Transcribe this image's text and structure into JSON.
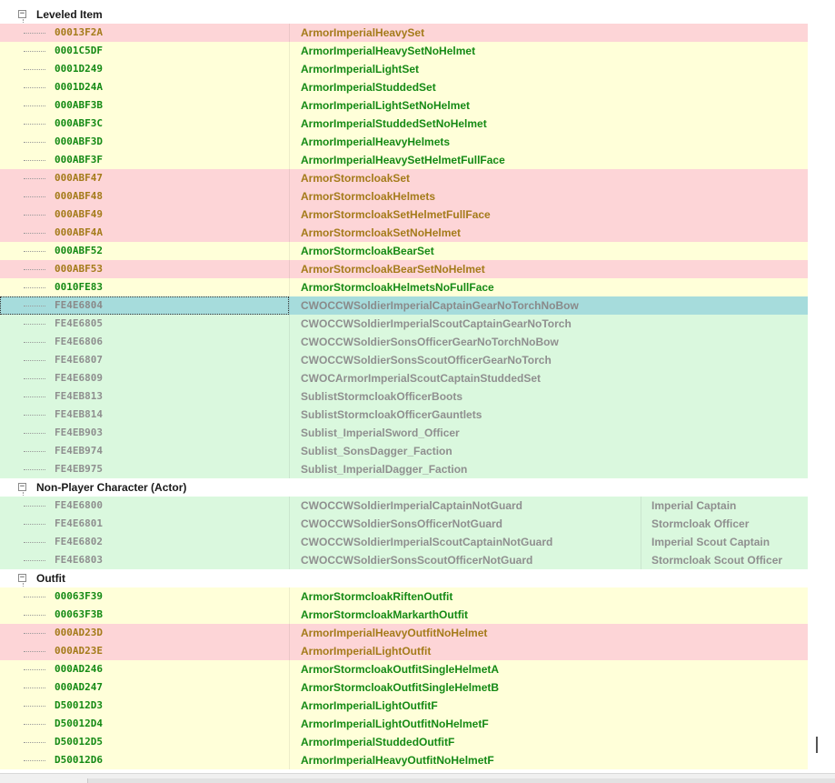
{
  "groups": [
    {
      "label": "Leveled Item",
      "expanded": true,
      "rows": [
        {
          "id": "00013F2A",
          "name": "ArmorImperialHeavySet",
          "state": "pink"
        },
        {
          "id": "0001C5DF",
          "name": "ArmorImperialHeavySetNoHelmet",
          "state": "yellow"
        },
        {
          "id": "0001D249",
          "name": "ArmorImperialLightSet",
          "state": "yellow"
        },
        {
          "id": "0001D24A",
          "name": "ArmorImperialStuddedSet",
          "state": "yellow"
        },
        {
          "id": "000ABF3B",
          "name": "ArmorImperialLightSetNoHelmet",
          "state": "yellow"
        },
        {
          "id": "000ABF3C",
          "name": "ArmorImperialStuddedSetNoHelmet",
          "state": "yellow"
        },
        {
          "id": "000ABF3D",
          "name": "ArmorImperialHeavyHelmets",
          "state": "yellow"
        },
        {
          "id": "000ABF3F",
          "name": "ArmorImperialHeavySetHelmetFullFace",
          "state": "yellow"
        },
        {
          "id": "000ABF47",
          "name": "ArmorStormcloakSet",
          "state": "pink"
        },
        {
          "id": "000ABF48",
          "name": "ArmorStormcloakHelmets",
          "state": "pink"
        },
        {
          "id": "000ABF49",
          "name": "ArmorStormcloakSetHelmetFullFace",
          "state": "pink"
        },
        {
          "id": "000ABF4A",
          "name": "ArmorStormcloakSetNoHelmet",
          "state": "pink"
        },
        {
          "id": "000ABF52",
          "name": "ArmorStormcloakBearSet",
          "state": "yellow"
        },
        {
          "id": "000ABF53",
          "name": "ArmorStormcloakBearSetNoHelmet",
          "state": "pink"
        },
        {
          "id": "0010FE83",
          "name": "ArmorStormcloakHelmetsNoFullFace",
          "state": "yellow"
        },
        {
          "id": "FE4E6804",
          "name": "CWOCCWSoldierImperialCaptainGearNoTorchNoBow",
          "state": "selected"
        },
        {
          "id": "FE4E6805",
          "name": "CWOCCWSoldierImperialScoutCaptainGearNoTorch",
          "state": "green"
        },
        {
          "id": "FE4E6806",
          "name": "CWOCCWSoldierSonsOfficerGearNoTorchNoBow",
          "state": "green"
        },
        {
          "id": "FE4E6807",
          "name": "CWOCCWSoldierSonsScoutOfficerGearNoTorch",
          "state": "green"
        },
        {
          "id": "FE4E6809",
          "name": "CWOCArmorImperialScoutCaptainStuddedSet",
          "state": "green"
        },
        {
          "id": "FE4EB813",
          "name": "SublistStormcloakOfficerBoots",
          "state": "green"
        },
        {
          "id": "FE4EB814",
          "name": "SublistStormcloakOfficerGauntlets",
          "state": "green"
        },
        {
          "id": "FE4EB903",
          "name": "Sublist_ImperialSword_Officer",
          "state": "green"
        },
        {
          "id": "FE4EB974",
          "name": "Sublist_SonsDagger_Faction",
          "state": "green"
        },
        {
          "id": "FE4EB975",
          "name": "Sublist_ImperialDagger_Faction",
          "state": "green"
        }
      ]
    },
    {
      "label": "Non-Player Character (Actor)",
      "expanded": true,
      "rows": [
        {
          "id": "FE4E6800",
          "name": "CWOCCWSoldierImperialCaptainNotGuard",
          "extra": "Imperial Captain",
          "state": "green"
        },
        {
          "id": "FE4E6801",
          "name": "CWOCCWSoldierSonsOfficerNotGuard",
          "extra": "Stormcloak Officer",
          "state": "green"
        },
        {
          "id": "FE4E6802",
          "name": "CWOCCWSoldierImperialScoutCaptainNotGuard",
          "extra": "Imperial Scout Captain",
          "state": "green"
        },
        {
          "id": "FE4E6803",
          "name": "CWOCCWSoldierSonsScoutOfficerNotGuard",
          "extra": "Stormcloak Scout Officer",
          "state": "green"
        }
      ]
    },
    {
      "label": "Outfit",
      "expanded": true,
      "rows": [
        {
          "id": "00063F39",
          "name": "ArmorStormcloakRiftenOutfit",
          "state": "yellow"
        },
        {
          "id": "00063F3B",
          "name": "ArmorStormcloakMarkarthOutfit",
          "state": "yellow"
        },
        {
          "id": "000AD23D",
          "name": "ArmorImperialHeavyOutfitNoHelmet",
          "state": "pink"
        },
        {
          "id": "000AD23E",
          "name": "ArmorImperialLightOutfit",
          "state": "pink"
        },
        {
          "id": "000AD246",
          "name": "ArmorStormcloakOutfitSingleHelmetA",
          "state": "yellow"
        },
        {
          "id": "000AD247",
          "name": "ArmorStormcloakOutfitSingleHelmetB",
          "state": "yellow"
        },
        {
          "id": "D50012D3",
          "name": "ArmorImperialLightOutfitF",
          "state": "yellow"
        },
        {
          "id": "D50012D4",
          "name": "ArmorImperialLightOutfitNoHelmetF",
          "state": "yellow"
        },
        {
          "id": "D50012D5",
          "name": "ArmorImperialStuddedOutfitF",
          "state": "yellow"
        },
        {
          "id": "D50012D6",
          "name": "ArmorImperialHeavyOutfitNoHelmetF",
          "state": "yellow"
        }
      ]
    }
  ],
  "toggle_glyph_expanded": "−",
  "colors": {
    "row_conflict_winner": "#ffffd9",
    "row_conflict_loser": "#fdd5d7",
    "row_new_record": "#daf8de",
    "row_selected": "#a6dcdc"
  }
}
